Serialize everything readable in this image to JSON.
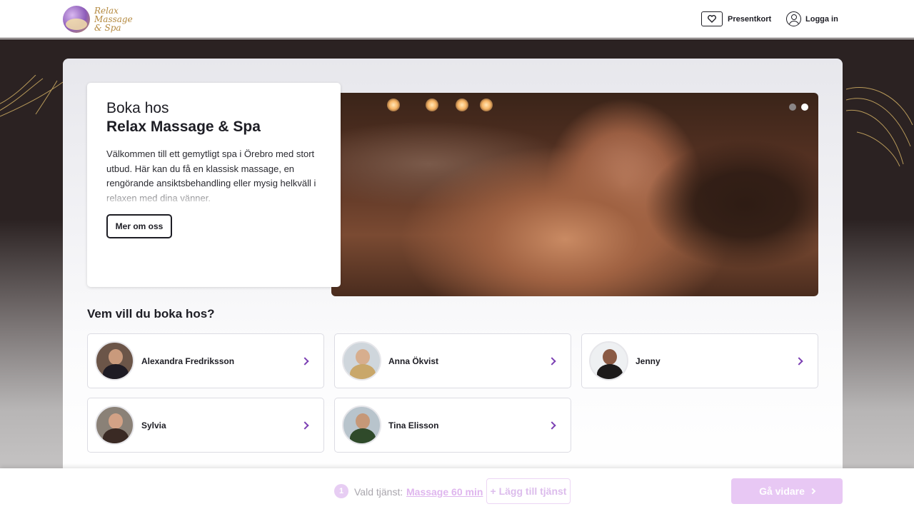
{
  "header": {
    "logo_lines": [
      "Relax",
      "Massage",
      "& Spa"
    ],
    "giftcard_label": "Presentkort",
    "login_label": "Logga in"
  },
  "intro": {
    "pre_title": "Boka hos",
    "title": "Relax Massage & Spa",
    "text": "Välkommen till ett gemytligt spa i Örebro med stort utbud. Här kan du få en klassisk massage, en rengörande ansiktsbehandling eller mysig helkväll i relaxen med dina vänner.",
    "more_button": "Mer om oss"
  },
  "carousel": {
    "slides": 2,
    "active_slide": 2
  },
  "staff": {
    "heading": "Vem vill du boka hos?",
    "members": [
      {
        "name": "Alexandra Fredriksson"
      },
      {
        "name": "Anna Ökvist"
      },
      {
        "name": "Jenny"
      },
      {
        "name": "Sylvia"
      },
      {
        "name": "Tina Elisson"
      }
    ]
  },
  "bottom_bar": {
    "step_number": "1",
    "selected_label": "Vald tjänst:",
    "selected_service": "Massage 60 min",
    "add_service": "+ Lägg till tjänst",
    "next_button": "Gå vidare"
  },
  "colors": {
    "accent": "#7b3fb3",
    "accent_light": "#e8c8f4",
    "text_dark": "#1d1d24",
    "background_dark": "#2b2222"
  }
}
